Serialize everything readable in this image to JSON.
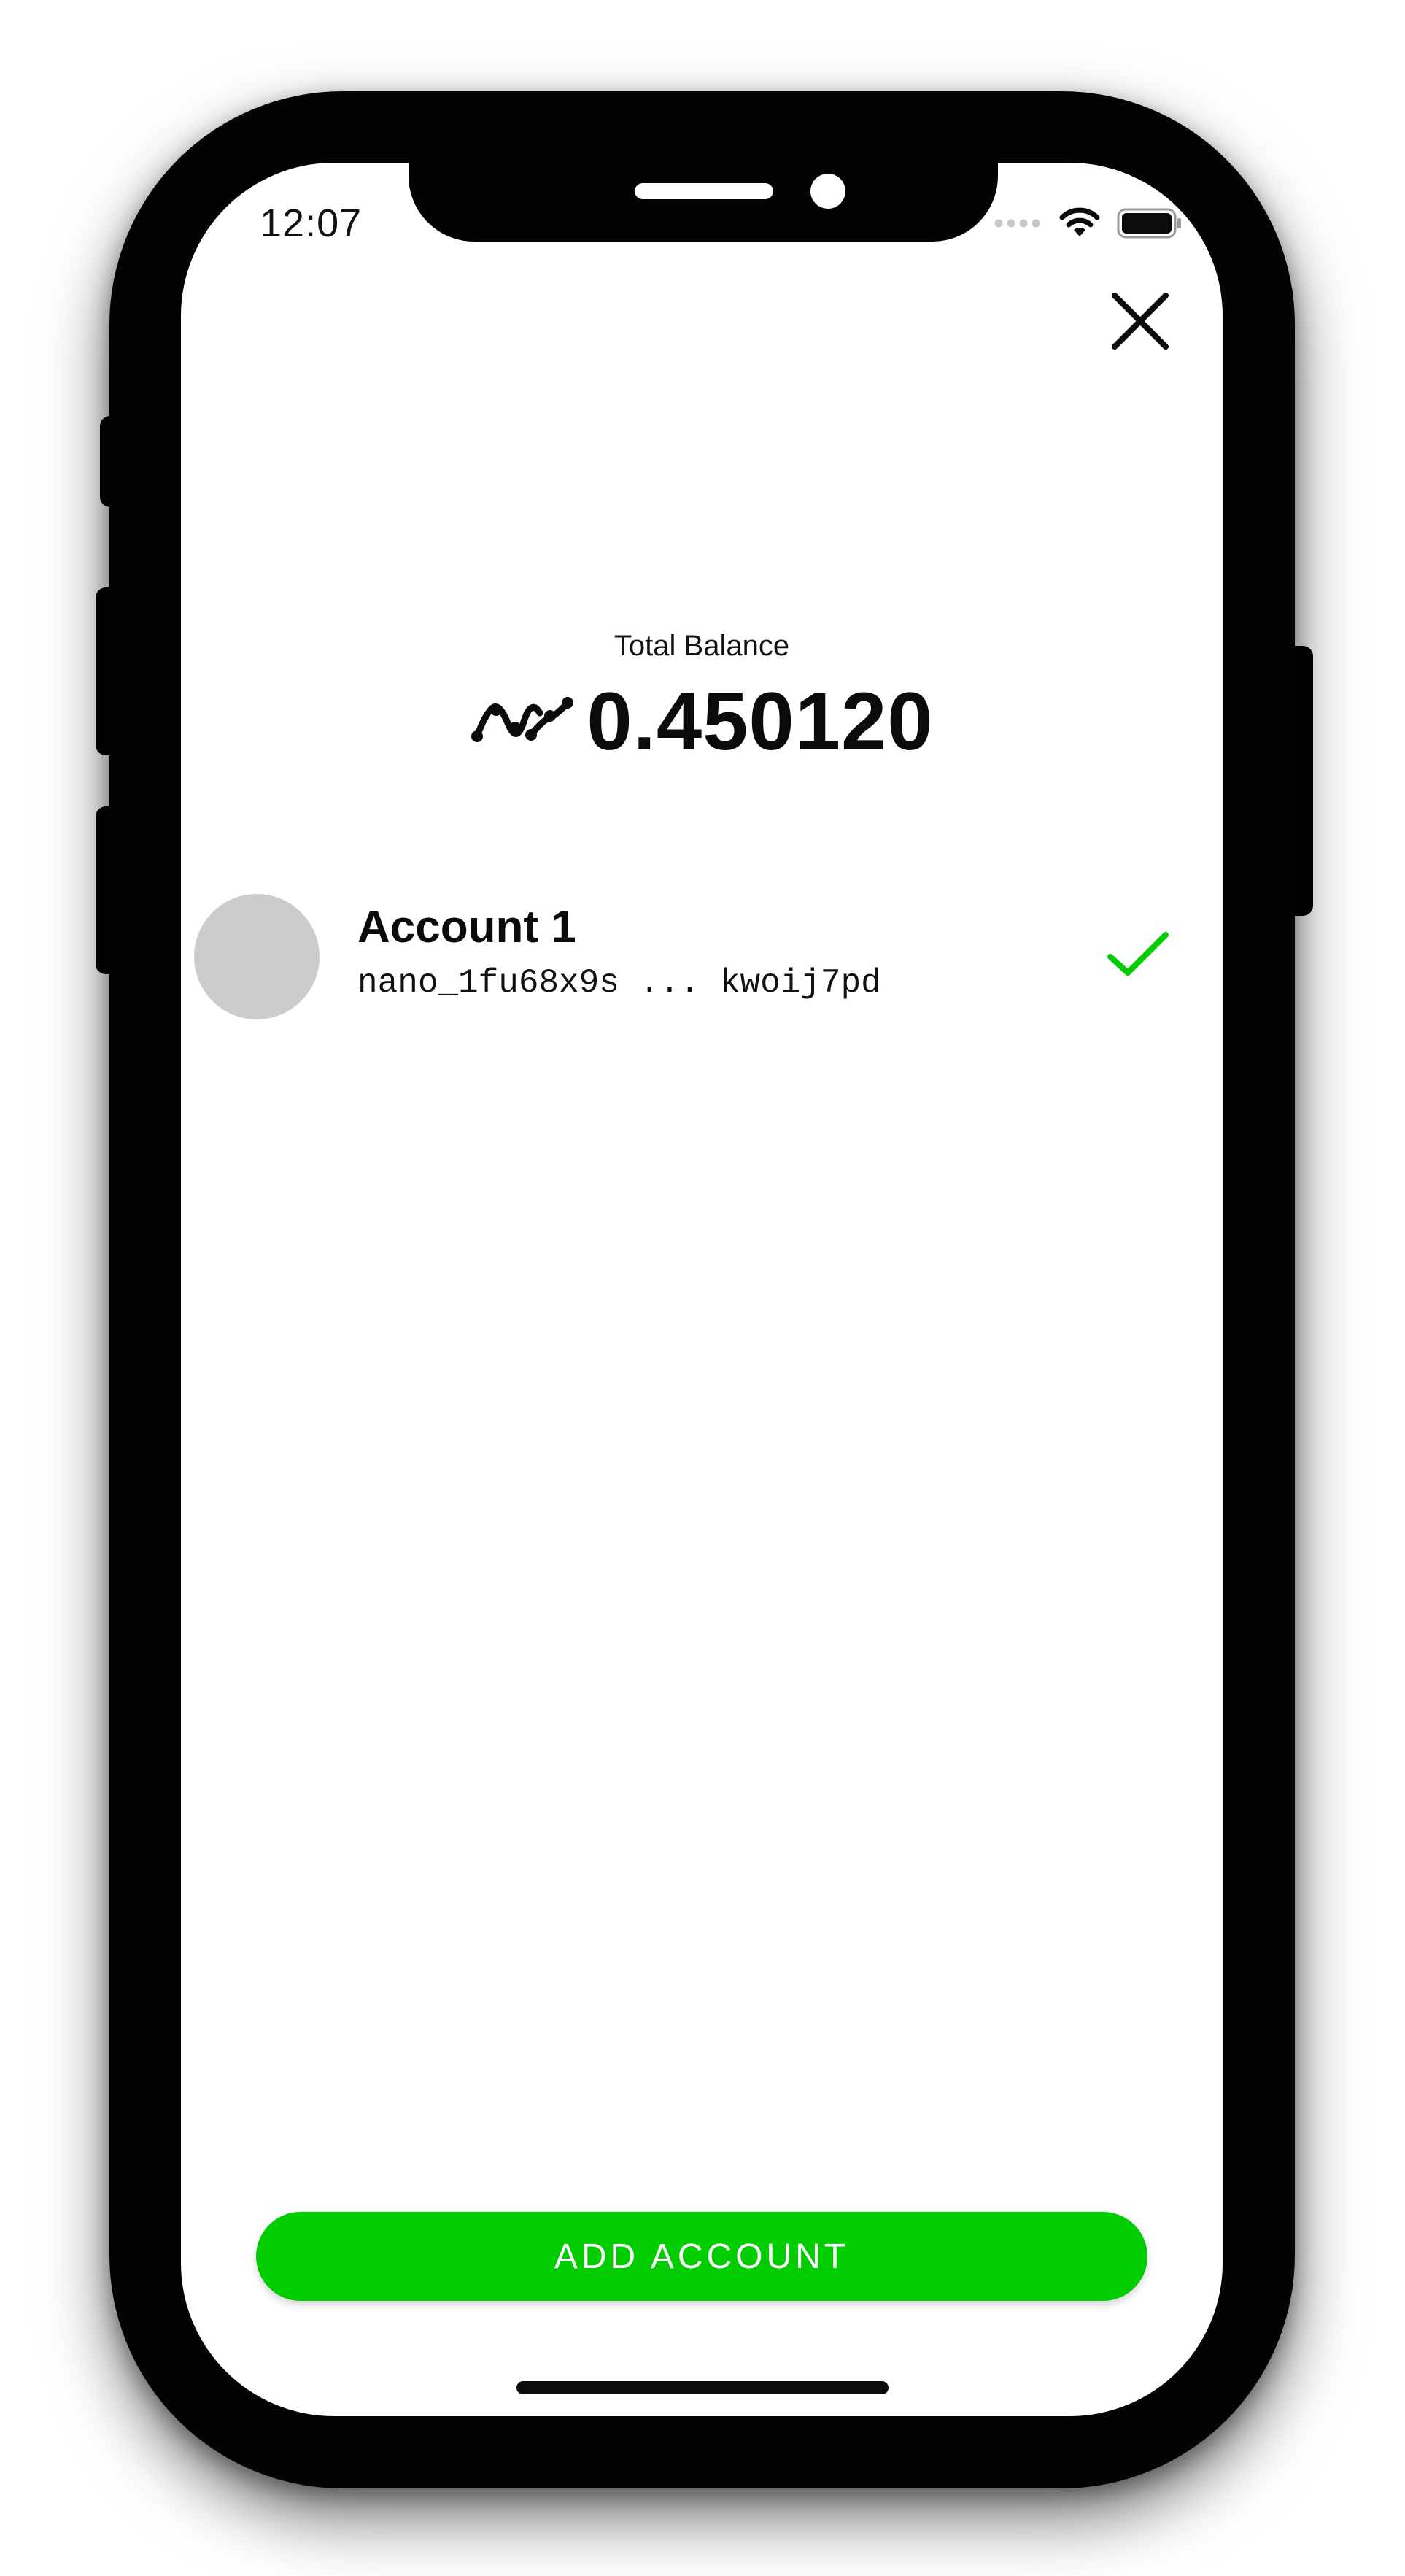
{
  "status_bar": {
    "time": "12:07",
    "icons": [
      "signal-icon",
      "wifi-icon",
      "battery-icon"
    ]
  },
  "header": {
    "close_icon": "close-icon"
  },
  "balance": {
    "label": "Total Balance",
    "currency_icon": "nano-logo-icon",
    "value": "0.450120"
  },
  "accounts": [
    {
      "name": "Account 1",
      "address": "nano_1fu68x9s ... kwoij7pd",
      "selected": true,
      "avatar_color": "#cccccc",
      "check_icon": "checkmark-icon"
    }
  ],
  "actions": {
    "add_account_label": "ADD ACCOUNT"
  },
  "colors": {
    "accent": "#00cc00",
    "text": "#0b0b0b",
    "avatar": "#cccccc",
    "device": "#030303"
  }
}
